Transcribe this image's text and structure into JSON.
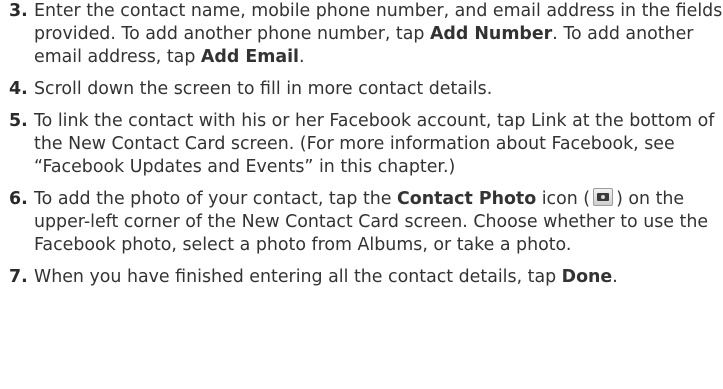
{
  "steps": [
    {
      "num": "3.",
      "parts": [
        "Enter the contact name, mobile phone number, and email address in the fields provided. To add another phone number, tap ",
        "Add Number",
        ". To add another email address, tap ",
        "Add Email",
        "."
      ]
    },
    {
      "num": "4.",
      "text": "Scroll down the screen to fill in more contact details."
    },
    {
      "num": "5.",
      "text": "To link the contact with his or her Facebook account, tap Link at the bottom of the New Contact Card screen. (For more information about Facebook, see “Facebook Updates and Events” in this chapter.)"
    },
    {
      "num": "6.",
      "parts": [
        "To add the photo of your contact, tap the ",
        "Contact Photo",
        " icon (",
        ") on the upper-left corner of the New Contact Card screen. Choose whether to use the Facebook photo, select a photo from Albums, or take a photo."
      ],
      "icon": "contact-photo-icon"
    },
    {
      "num": "7.",
      "parts": [
        "When you have finished entering all the contact details, tap ",
        "Done",
        "."
      ]
    }
  ]
}
